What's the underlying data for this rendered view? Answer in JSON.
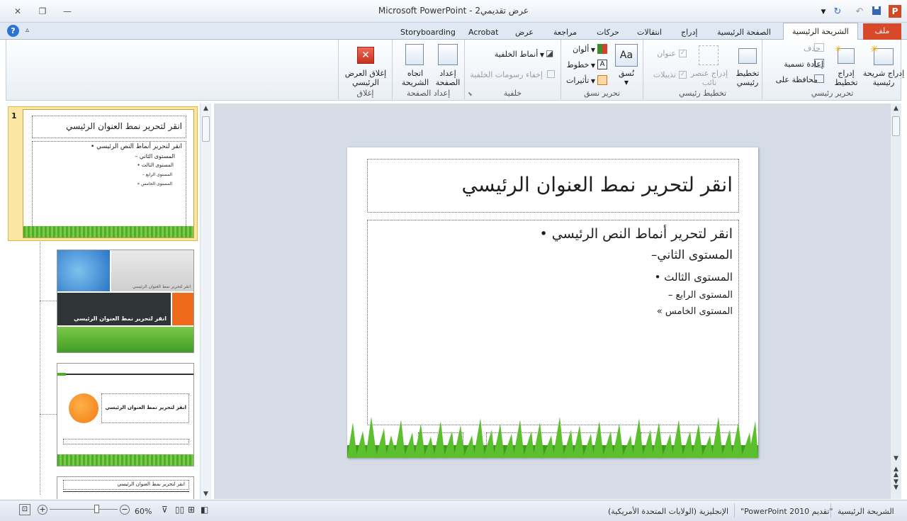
{
  "window": {
    "title": "عرض تقديمي2 - Microsoft PowerPoint",
    "min_icon": "minimize-icon",
    "restore_icon": "restore-icon",
    "close_icon": "close-icon"
  },
  "tabs": [
    {
      "label": "ملف"
    },
    {
      "label": "الشريحة الرئيسية"
    },
    {
      "label": "الصفحة الرئيسية"
    },
    {
      "label": "إدراج"
    },
    {
      "label": "انتقالات"
    },
    {
      "label": "حركات"
    },
    {
      "label": "مراجعة"
    },
    {
      "label": "عرض"
    },
    {
      "label": "Acrobat"
    },
    {
      "label": "Storyboarding"
    }
  ],
  "ribbon": {
    "edit_master": {
      "label": "تحرير رئيسي",
      "insert_master": "إدراج شريحة رئيسية",
      "insert_layout": "إدراج تخطيط",
      "delete": "حذف",
      "rename": "إعادة تسمية",
      "preserve": "محافظة على"
    },
    "master_layout": {
      "label": "تخطيط رئيسي",
      "master_layout_btn": "تخطيط رئيسي",
      "insert_placeholder": "إدراج عنصر نائب",
      "title_chk": "عنوان",
      "footers_chk": "تذييلات"
    },
    "edit_theme": {
      "label": "تحرير نسق",
      "themes": "نُسق",
      "colors": "ألوان",
      "fonts": "خطوط",
      "effects": "تأثيرات"
    },
    "background": {
      "label": "خلفية",
      "styles": "أنماط الخلفية",
      "hide_graphics": "إخفاء رسومات الخلفية"
    },
    "page_setup": {
      "label": "إعداد الصفحة",
      "page_setup_btn": "إعداد الصفحة",
      "orientation": "اتجاه الشريحة"
    },
    "close": {
      "label": "إغلاق",
      "close_btn": "إغلاق العرض الرئيسي"
    }
  },
  "thumbs": {
    "t1": {
      "number": "1",
      "title": "انقر لتحرير نمط العنوان الرئيسي",
      "body": "انقر لتحرير أنماط النص الرئيسي •",
      "l2": "المستوى الثاني –",
      "l3": "المستوى الثالث •",
      "l4": "المستوى الرابع –",
      "l5": "المستوى الخامس »"
    },
    "t2": {
      "title": "انقر لتحرير نمط العنوان الرئيسي",
      "sub": "انقر لتحرير نمط العنوان الرئيسي"
    },
    "t3": {
      "title": "انقر لتحرير نمط العنوان الرئيسي"
    },
    "t4": {
      "title": "انقر لتحرير نمط العنوان الرئيسي"
    }
  },
  "slide": {
    "title": "انقر لتحرير نمط العنوان الرئيسي",
    "level1": "انقر لتحرير أنماط النص الرئيسي",
    "level2": "المستوى الثاني",
    "level3": "المستوى الثالث",
    "level4": "المستوى الرابع",
    "level5": "المستوى الخامس"
  },
  "status": {
    "view": "الشريحة الرئيسية",
    "theme": "\"تقديم PowerPoint 2010\"",
    "language": "الإنجليزية (الولايات المتحدة الأمريكية)",
    "zoom": "60%"
  },
  "colors": {
    "file_tab": "#d8492a",
    "selected_thumb": "#fbe7a3",
    "grass": "#4caf2a"
  }
}
